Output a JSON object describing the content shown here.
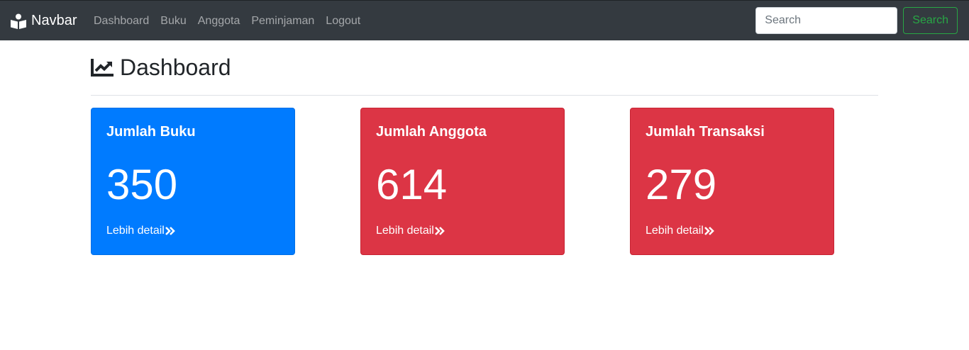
{
  "navbar": {
    "brand": "Navbar",
    "brand_icon": "book-reader-icon",
    "links": [
      "Dashboard",
      "Buku",
      "Anggota",
      "Peminjaman",
      "Logout"
    ],
    "search": {
      "placeholder": "Search",
      "value": "",
      "button_label": "Search"
    },
    "colors": {
      "background": "#343a40",
      "search_button": "#28a745"
    }
  },
  "page": {
    "title": "Dashboard",
    "title_icon": "chart-line-icon"
  },
  "cards": [
    {
      "title": "Jumlah Buku",
      "value": "350",
      "link": "Lebih detail",
      "link_icon": "angle-double-right-icon",
      "color": "#007bff"
    },
    {
      "title": "Jumlah Anggota",
      "value": "614",
      "link": "Lebih detail",
      "link_icon": "angle-double-right-icon",
      "color": "#dc3545"
    },
    {
      "title": "Jumlah Transaksi",
      "value": "279",
      "link": "Lebih detail",
      "link_icon": "angle-double-right-icon",
      "color": "#dc3545"
    }
  ]
}
